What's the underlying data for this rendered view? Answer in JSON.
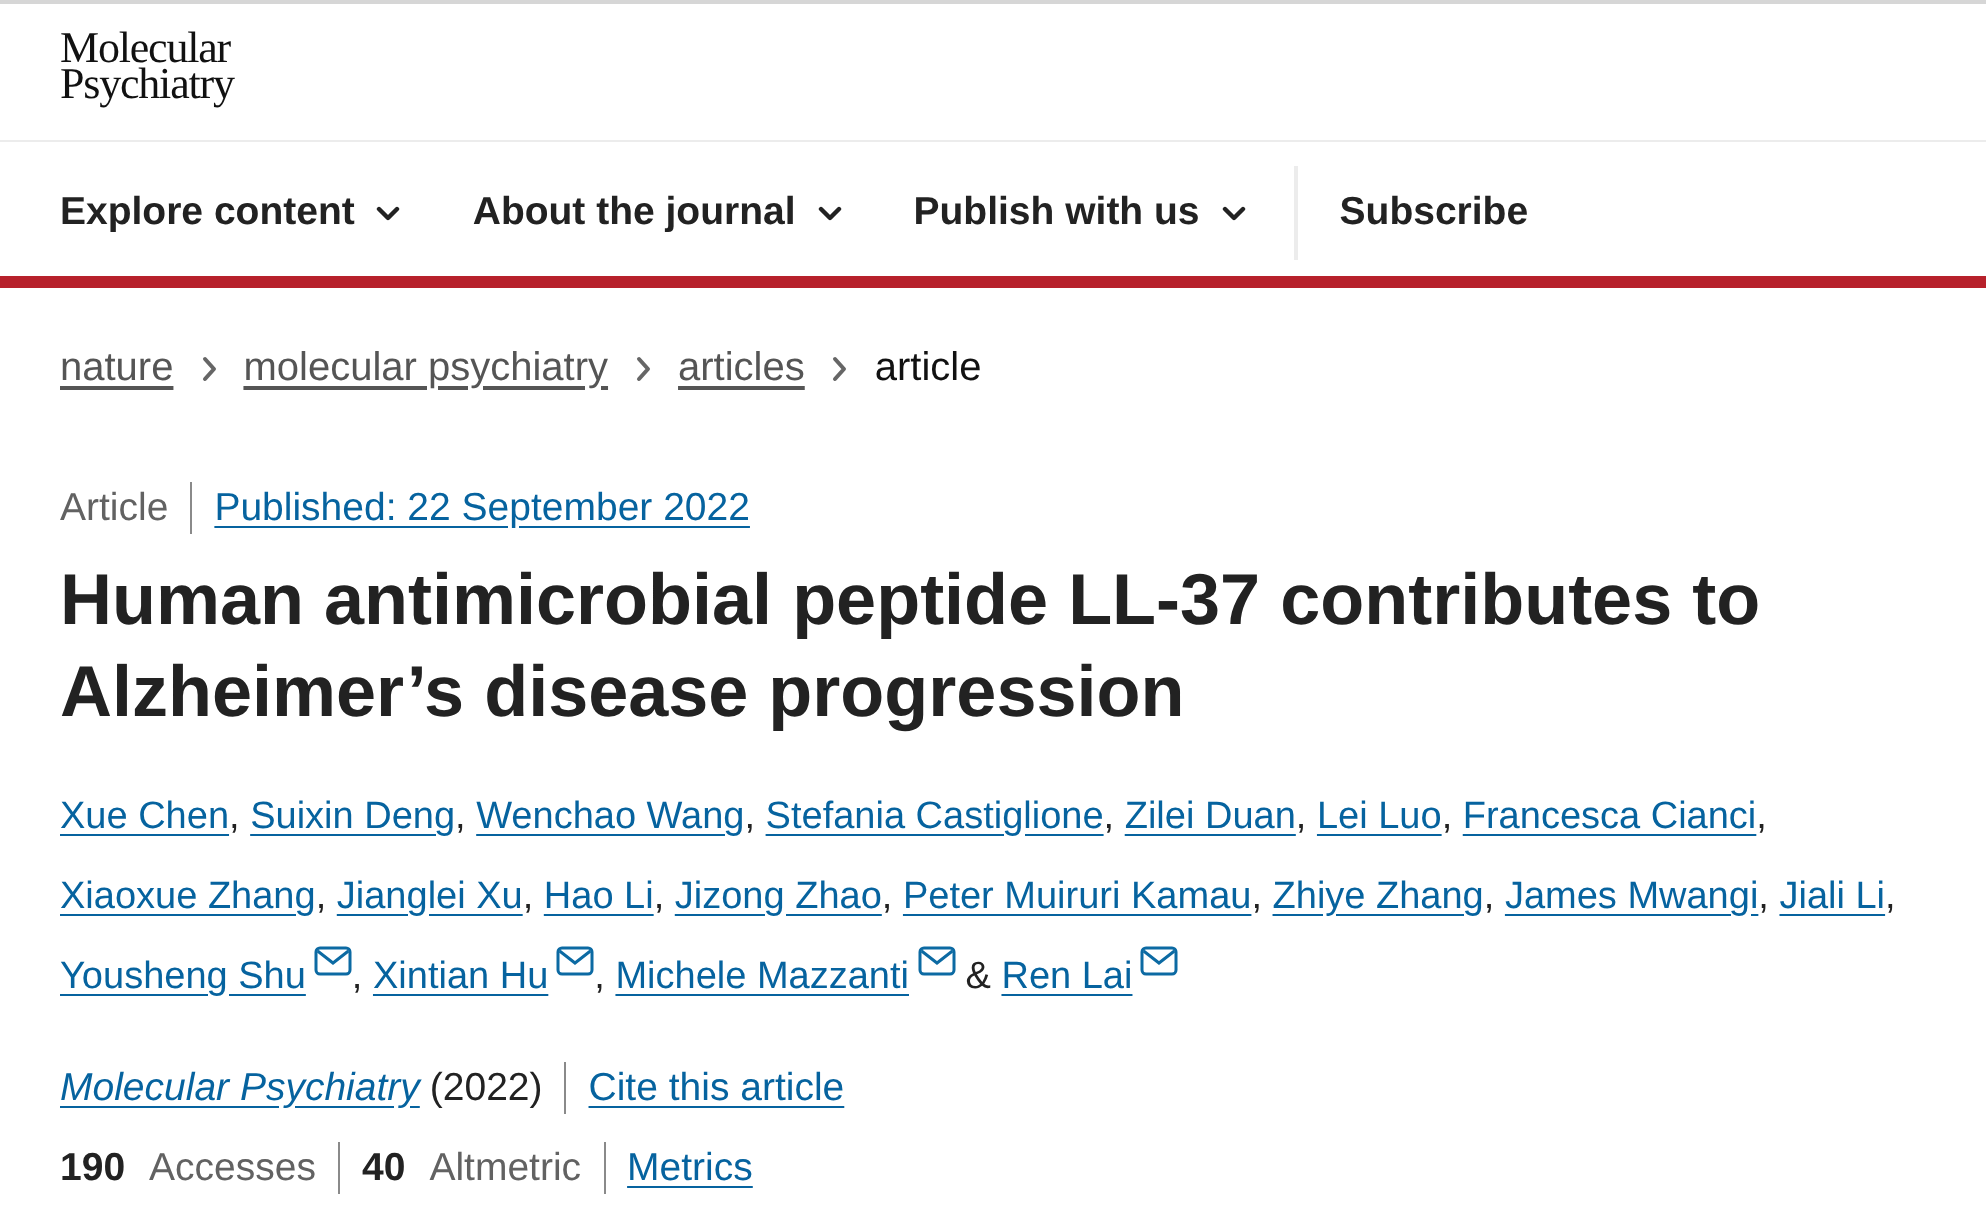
{
  "header": {
    "logo": [
      "Molecular",
      "Psychiatry"
    ]
  },
  "nav": [
    {
      "label": "Explore content",
      "kind": "menu"
    },
    {
      "label": "About the journal",
      "kind": "menu"
    },
    {
      "label": "Publish with us",
      "kind": "menu"
    },
    {
      "label": "Subscribe",
      "kind": "link"
    }
  ],
  "breadcrumbs": [
    {
      "label": "nature",
      "current": false
    },
    {
      "label": "molecular psychiatry",
      "current": false
    },
    {
      "label": "articles",
      "current": false
    },
    {
      "label": "article",
      "current": true
    }
  ],
  "article": {
    "type": "Article",
    "published": "Published: 22 September 2022",
    "title": "Human antimicrobial peptide LL-37 contributes to Alzheimer’s disease progression",
    "authors": [
      {
        "name": "Xue Chen",
        "email": false,
        "separator": {
          "text": ",",
          "kind": "comma"
        }
      },
      {
        "name": "Suixin Deng",
        "email": false,
        "separator": {
          "text": ",",
          "kind": "comma"
        }
      },
      {
        "name": "Wenchao Wang",
        "email": false,
        "separator": {
          "text": ",",
          "kind": "comma"
        }
      },
      {
        "name": "Stefania Castiglione",
        "email": false,
        "separator": {
          "text": ",",
          "kind": "comma"
        }
      },
      {
        "name": "Zilei Duan",
        "email": false,
        "separator": {
          "text": ",",
          "kind": "comma"
        }
      },
      {
        "name": "Lei Luo",
        "email": false,
        "separator": {
          "text": ",",
          "kind": "comma"
        }
      },
      {
        "name": "Francesca Cianci",
        "email": false,
        "separator": {
          "text": ",",
          "kind": "comma"
        }
      },
      {
        "name": "Xiaoxue Zhang",
        "email": false,
        "separator": {
          "text": ",",
          "kind": "comma"
        }
      },
      {
        "name": "Jianglei Xu",
        "email": false,
        "separator": {
          "text": ",",
          "kind": "comma"
        }
      },
      {
        "name": "Hao Li",
        "email": false,
        "separator": {
          "text": ",",
          "kind": "comma"
        }
      },
      {
        "name": "Jizong Zhao",
        "email": false,
        "separator": {
          "text": ",",
          "kind": "comma"
        }
      },
      {
        "name": "Peter Muiruri Kamau",
        "email": false,
        "separator": {
          "text": ",",
          "kind": "comma"
        }
      },
      {
        "name": "Zhiye Zhang",
        "email": false,
        "separator": {
          "text": ",",
          "kind": "comma"
        }
      },
      {
        "name": "James Mwangi",
        "email": false,
        "separator": {
          "text": ",",
          "kind": "comma"
        }
      },
      {
        "name": "Jiali Li",
        "email": false,
        "separator": {
          "text": ",",
          "kind": "comma"
        }
      },
      {
        "name": "Yousheng Shu",
        "email": true,
        "separator": {
          "text": ",",
          "kind": "comma"
        }
      },
      {
        "name": "Xintian Hu",
        "email": true,
        "separator": {
          "text": ",",
          "kind": "comma"
        }
      },
      {
        "name": "Michele Mazzanti",
        "email": true,
        "separator": {
          "text": "&",
          "kind": "conjunction"
        }
      },
      {
        "name": "Ren Lai",
        "email": true
      }
    ],
    "journal": {
      "name": "Molecular Psychiatry",
      "year": "(2022)",
      "cite": "Cite this article"
    },
    "metrics": [
      {
        "count": "190",
        "name": "Accesses"
      },
      {
        "count": "40",
        "name": "Altmetric"
      }
    ],
    "metrics_link": "Metrics"
  }
}
